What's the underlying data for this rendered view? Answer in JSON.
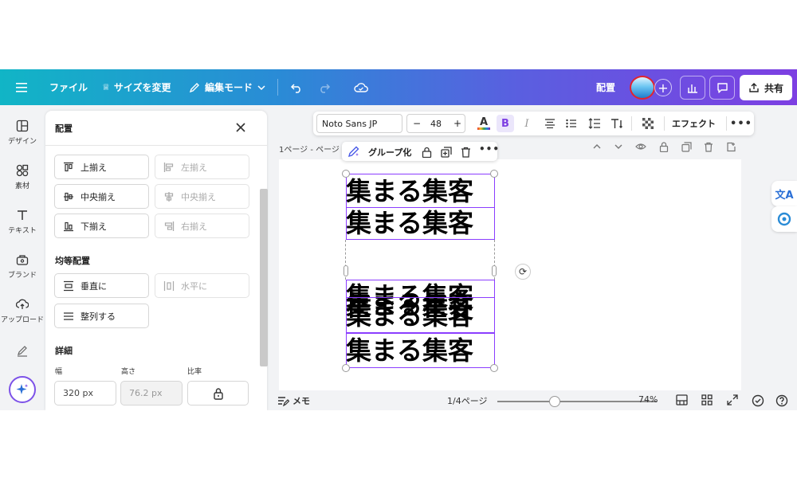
{
  "topbar": {
    "menu_icon": "hamburger-icon",
    "file_label": "ファイル",
    "resize_label": "サイズを変更",
    "edit_mode_label": "編集モード",
    "position_label": "配置",
    "share_label": "共有",
    "gradient_colors": [
      "#11b5c6",
      "#7d3fe2"
    ]
  },
  "rail": {
    "items": [
      {
        "label": "デザイン",
        "icon": "design-icon"
      },
      {
        "label": "素材",
        "icon": "elements-icon"
      },
      {
        "label": "テキスト",
        "icon": "text-icon"
      },
      {
        "label": "ブランド",
        "icon": "brand-icon"
      },
      {
        "label": "アップロード",
        "icon": "upload-icon"
      }
    ],
    "draw_icon": "draw-icon",
    "magic_icon": "magic-sparkle-icon"
  },
  "panel": {
    "title": "配置",
    "align": {
      "top": "上揃え",
      "left": "左揃え",
      "middle": "中央揃え",
      "center": "中央揃え",
      "bottom": "下揃え",
      "right": "右揃え"
    },
    "distribute_title": "均等配置",
    "distribute": {
      "vertical": "垂直に",
      "horizontal": "水平に",
      "tidy": "整列する"
    },
    "details_title": "詳細",
    "width_label": "幅",
    "height_label": "高さ",
    "ratio_label": "比率",
    "width_value": "320 px",
    "height_value": "76.2 px"
  },
  "text_toolbar": {
    "font": "Noto Sans JP",
    "size_minus": "−",
    "size": "48",
    "size_plus": "+",
    "effect_label": "エフェクト",
    "accent_color": "#8b3dff"
  },
  "canvas": {
    "page_label": "1ページ - ページ",
    "group_label": "グループ化",
    "texts": [
      "集まる集客",
      "集まる集客",
      "集まる集客",
      "集まる集客",
      "集まる集客",
      "集まる集客"
    ]
  },
  "bottom": {
    "notes_label": "メモ",
    "page_count": "1/4ページ",
    "zoom": "74%",
    "zoom_level": 0.36
  }
}
